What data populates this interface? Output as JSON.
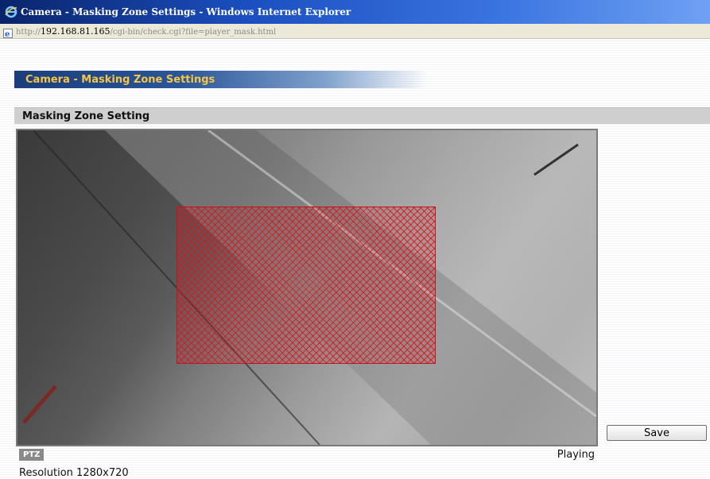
{
  "window": {
    "title": "Camera - Masking Zone Settings - Windows Internet Explorer",
    "icon": "internet-explorer-icon"
  },
  "address_bar": {
    "url_prefix": "http://",
    "url_host": "192.168.81.165",
    "url_path": "/cgi-bin/check.cgi?file=player_mask.html",
    "icon": "page-icon"
  },
  "page": {
    "header_title": "Camera - Masking Zone Settings",
    "section_title": "Masking Zone Setting"
  },
  "player": {
    "ptz_label": "PTZ",
    "status": "Playing",
    "resolution": "Resolution 1280x720"
  },
  "actions": {
    "save_label": "Save"
  },
  "colors": {
    "title_bar": "#1b4fc0",
    "header_text": "#f6c544",
    "mask": "#c8101a"
  }
}
